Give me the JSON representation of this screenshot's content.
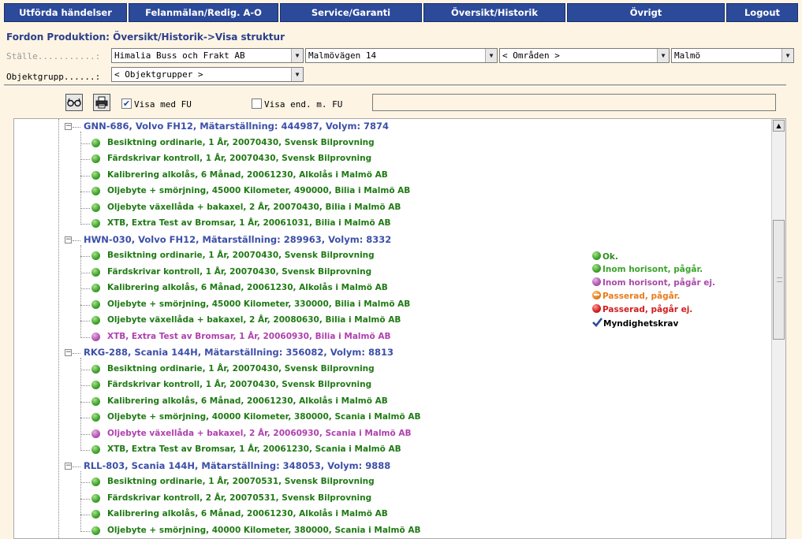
{
  "nav": [
    "Utförda händelser",
    "Felanmälan/Redig. A-O",
    "Service/Garanti",
    "Översikt/Historik",
    "Övrigt",
    "Logout"
  ],
  "page_title": "Fordon Produktion: Översikt/Historik->Visa struktur",
  "filters": {
    "stalle_label": "Ställe...........:",
    "stalle_value": "Himalia Buss och Frakt AB",
    "address_value": "Malmövägen 14",
    "area_value": "< Områden >",
    "city_value": "Malmö",
    "objektgrupp_label": "Objektgrupp......:",
    "objektgrupp_value": "< Objektgrupper >"
  },
  "toolbar": {
    "visa_med_fu": "Visa med FU",
    "visa_med_fu_checked": "✔",
    "visa_end_fu": "Visa end. m. FU"
  },
  "tree": [
    {
      "vehicle": "GNN-686, Volvo FH12, Mätarställning: 444987, Volym: 7874",
      "items": [
        {
          "text": "Besiktning ordinarie, 1 År, 20070430, Svensk Bilprovning",
          "status": "ok"
        },
        {
          "text": "Färdskrivar kontroll, 1 År, 20070430, Svensk Bilprovning",
          "status": "ok"
        },
        {
          "text": "Kalibrering alkolås, 6 Månad, 20061230, Alkolås i Malmö AB",
          "status": "ok"
        },
        {
          "text": "Oljebyte + smörjning, 45000 Kilometer, 490000, Bilia i Malmö AB",
          "status": "ok"
        },
        {
          "text": "Oljebyte växellåda + bakaxel, 2 År, 20070430, Bilia i Malmö AB",
          "status": "ok"
        },
        {
          "text": "XTB, Extra Test av Bromsar, 1 År, 20061031, Bilia i Malmö AB",
          "status": "ok"
        }
      ]
    },
    {
      "vehicle": "HWN-030, Volvo FH12, Mätarställning: 289963, Volym: 8332",
      "items": [
        {
          "text": "Besiktning ordinarie, 1 År, 20070430, Svensk Bilprovning",
          "status": "ok"
        },
        {
          "text": "Färdskrivar kontroll, 1 År, 20070430, Svensk Bilprovning",
          "status": "ok"
        },
        {
          "text": "Kalibrering alkolås, 6 Månad, 20061230, Alkolås i Malmö AB",
          "status": "ok"
        },
        {
          "text": "Oljebyte + smörjning, 45000 Kilometer, 330000, Bilia i Malmö AB",
          "status": "ok"
        },
        {
          "text": "Oljebyte växellåda + bakaxel, 2 År, 20080630, Bilia i Malmö AB",
          "status": "ok"
        },
        {
          "text": "XTB, Extra Test av Bromsar, 1 År, 20060930, Bilia i Malmö AB",
          "status": "ej"
        }
      ]
    },
    {
      "vehicle": "RKG-288, Scania 144H, Mätarställning: 356082, Volym: 8813",
      "items": [
        {
          "text": "Besiktning ordinarie, 1 År, 20070430, Svensk Bilprovning",
          "status": "ok"
        },
        {
          "text": "Färdskrivar kontroll, 1 År, 20070430, Svensk Bilprovning",
          "status": "ok"
        },
        {
          "text": "Kalibrering alkolås, 6 Månad, 20061230, Alkolås i Malmö AB",
          "status": "ok"
        },
        {
          "text": "Oljebyte + smörjning, 40000 Kilometer, 380000, Scania i Malmö AB",
          "status": "ok"
        },
        {
          "text": "Oljebyte växellåda + bakaxel, 2 År, 20060930, Scania i Malmö AB",
          "status": "ej"
        },
        {
          "text": "XTB, Extra Test av Bromsar, 1 År, 20061230, Scania i Malmö AB",
          "status": "ok"
        }
      ]
    },
    {
      "vehicle": "RLL-803, Scania 144H, Mätarställning: 348053, Volym: 9888",
      "items": [
        {
          "text": "Besiktning ordinarie, 1 År, 20070531, Svensk Bilprovning",
          "status": "ok"
        },
        {
          "text": "Färdskrivar kontroll, 2 År, 20070531, Svensk Bilprovning",
          "status": "ok"
        },
        {
          "text": "Kalibrering alkolås, 6 Månad, 20061230, Alkolås i Malmö AB",
          "status": "ok"
        },
        {
          "text": "Oljebyte + smörjning, 40000 Kilometer, 380000, Scania i Malmö AB",
          "status": "ok"
        }
      ]
    }
  ],
  "legend": [
    {
      "label": "Ok.",
      "color": "#2e8b1e",
      "icon": "green-dot-icon"
    },
    {
      "label": "Inom horisont, pågår.",
      "color": "#3aa52a",
      "icon": "green-dot-icon"
    },
    {
      "label": "Inom horisont, pågår ej.",
      "color": "#a94aa8",
      "icon": "purple-dot-icon"
    },
    {
      "label": "Passerad, pågår.",
      "color": "#e87d1e",
      "icon": "orange-minus-dot-icon"
    },
    {
      "label": "Passerad, pågår ej.",
      "color": "#d21e1e",
      "icon": "red-dot-icon"
    },
    {
      "label": "Myndighetskrav",
      "color": "#000000",
      "icon": "blue-checkmark-icon"
    }
  ],
  "colors": {
    "nav_bg": "#2b4a9a",
    "ok_text": "#1f7a14",
    "ej_text": "#b040ae",
    "vehicle_text": "#3c4fa8"
  }
}
